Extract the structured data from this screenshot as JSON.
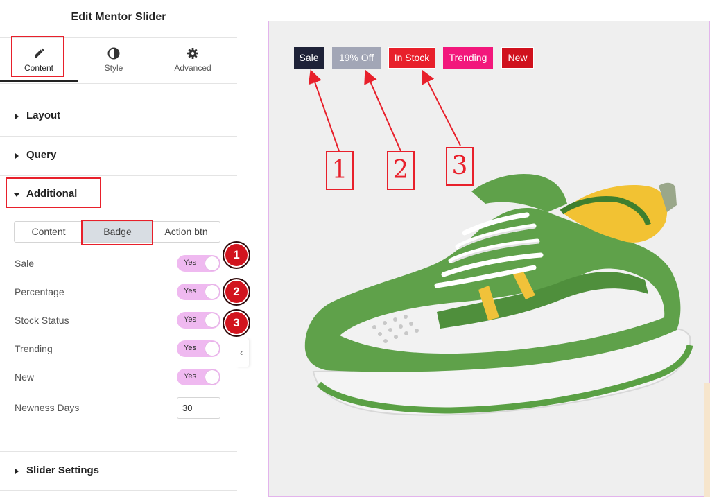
{
  "panel": {
    "title": "Edit Mentor Slider",
    "tabs": [
      {
        "label": "Content",
        "icon": "pencil-icon",
        "active": true
      },
      {
        "label": "Style",
        "icon": "contrast-icon",
        "active": false
      },
      {
        "label": "Advanced",
        "icon": "gear-icon",
        "active": false
      }
    ],
    "sections": {
      "layout": "Layout",
      "query": "Query",
      "additional": "Additional",
      "slider_settings": "Slider Settings"
    },
    "subtabs": [
      {
        "label": "Content",
        "active": false
      },
      {
        "label": "Badge",
        "active": true
      },
      {
        "label": "Action btn",
        "active": false
      }
    ],
    "rows": [
      {
        "label": "Sale",
        "value": "Yes",
        "marker": "1"
      },
      {
        "label": "Percentage",
        "value": "Yes",
        "marker": "2"
      },
      {
        "label": "Stock Status",
        "value": "Yes",
        "marker": "3"
      },
      {
        "label": "Trending",
        "value": "Yes",
        "marker": ""
      },
      {
        "label": "New",
        "value": "Yes",
        "marker": ""
      }
    ],
    "newness": {
      "label": "Newness Days",
      "value": "30"
    },
    "collapse_icon": "chevron-left-icon"
  },
  "preview": {
    "badges": [
      {
        "label": "Sale",
        "color": "#1e2238"
      },
      {
        "label": "19% Off",
        "color": "#a2a6b6"
      },
      {
        "label": "In Stock",
        "color": "#e8202b"
      },
      {
        "label": "Trending",
        "color": "#f2177c"
      },
      {
        "label": "New",
        "color": "#d0111d"
      }
    ],
    "callouts": [
      "1",
      "2",
      "3"
    ],
    "image": "green-sneaker-image"
  },
  "colors": {
    "highlight": "#e8202b",
    "toggle": "#efb9f0",
    "marker": "#d2141e",
    "preview_border": "#e3b4ec"
  }
}
